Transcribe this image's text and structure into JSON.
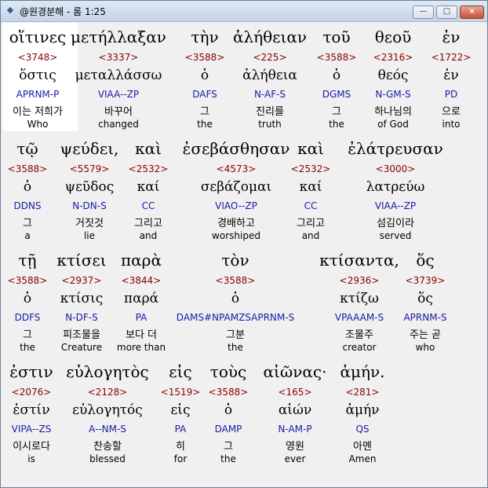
{
  "window": {
    "title": "@원경분해 - 롬 1:25",
    "buttons": {
      "minimize": "—",
      "maximize": "□",
      "close": "×"
    }
  },
  "rows": [
    {
      "words": [
        {
          "greek": "οἵτινες",
          "strong": "<3748>",
          "lemma": "ὅστις",
          "parse": "APRNM-P",
          "korean": "이는 저희가",
          "english": "Who"
        },
        {
          "greek": "μετήλλαξαν",
          "strong": "<3337>",
          "lemma": "μεταλλάσσω",
          "parse": "VIAA--ZP",
          "korean": "바꾸어",
          "english": "changed"
        },
        {
          "greek": "τὴν",
          "strong": "<3588>",
          "lemma": "ὁ",
          "parse": "DAFS",
          "korean": "그",
          "english": "the"
        },
        {
          "greek": "ἀλήθειαν",
          "strong": "<225>",
          "lemma": "ἀλήθεια",
          "parse": "N-AF-S",
          "korean": "진리를",
          "english": "truth"
        },
        {
          "greek": "τοῦ",
          "strong": "<3588>",
          "lemma": "ὁ",
          "parse": "DGMS",
          "korean": "그",
          "english": "the"
        },
        {
          "greek": "θεοῦ",
          "strong": "<2316>",
          "lemma": "θεός",
          "parse": "N-GM-S",
          "korean": "하나님의",
          "english": "of God"
        },
        {
          "greek": "ἐν",
          "strong": "<1722>",
          "lemma": "ἐν",
          "parse": "PD",
          "korean": "으로",
          "english": "into"
        }
      ]
    },
    {
      "words": [
        {
          "greek": "τῷ",
          "strong": "<3588>",
          "lemma": "ὁ",
          "parse": "DDNS",
          "korean": "그",
          "english": "a"
        },
        {
          "greek": "ψεύδει,",
          "strong": "<5579>",
          "lemma": "ψεῦδος",
          "parse": "N-DN-S",
          "korean": "거짓것",
          "english": "lie"
        },
        {
          "greek": "καὶ",
          "strong": "<2532>",
          "lemma": "καί",
          "parse": "CC",
          "korean": "그리고",
          "english": "and"
        },
        {
          "greek": "ἐσεβάσθησαν",
          "strong": "<4573>",
          "lemma": "σεβάζομαι",
          "parse": "VIAO--ZP",
          "korean": "경배하고",
          "english": "worshiped"
        },
        {
          "greek": "καὶ",
          "strong": "<2532>",
          "lemma": "καί",
          "parse": "CC",
          "korean": "그리고",
          "english": "and"
        },
        {
          "greek": "ἐλάτρευσαν",
          "strong": "<3000>",
          "lemma": "λατρεύω",
          "parse": "VIAA--ZP",
          "korean": "섬김이라",
          "english": "served"
        }
      ]
    },
    {
      "words": [
        {
          "greek": "τῇ",
          "strong": "<3588>",
          "lemma": "ὁ",
          "parse": "DDFS",
          "korean": "그",
          "english": "the"
        },
        {
          "greek": "κτίσει",
          "strong": "<2937>",
          "lemma": "κτίσις",
          "parse": "N-DF-S",
          "korean": "피조물을",
          "english": "Creature"
        },
        {
          "greek": "παρὰ",
          "strong": "<3844>",
          "lemma": "παρά",
          "parse": "PA",
          "korean": "보다 더",
          "english": "more than"
        },
        {
          "greek": "τὸν",
          "strong": "<3588>",
          "lemma": "ὁ",
          "parse": "DAMS#NPAMZSAPRNM-S",
          "korean": "그분",
          "english": "the"
        },
        {
          "greek": "κτίσαντα,",
          "strong": "<2936>",
          "lemma": "κτίζω",
          "parse": "VPAAAM-S",
          "korean": "조물주",
          "english": "creator"
        },
        {
          "greek": "ὅς",
          "strong": "<3739>",
          "lemma": "ὅς",
          "parse": "APRNM-S",
          "korean": "주는 곧",
          "english": "who"
        }
      ]
    },
    {
      "words": [
        {
          "greek": "ἐστιν",
          "strong": "<2076>",
          "lemma": "ἐστίν",
          "parse": "VIPA--ZS",
          "korean": "이시로다",
          "english": "is"
        },
        {
          "greek": "εὐλογητὸς",
          "strong": "<2128>",
          "lemma": "εὐλογητός",
          "parse": "A--NM-S",
          "korean": "찬송할",
          "english": "blessed"
        },
        {
          "greek": "εἰς",
          "strong": "<1519>",
          "lemma": "εἰς",
          "parse": "PA",
          "korean": "히",
          "english": "for"
        },
        {
          "greek": "τοὺς",
          "strong": "<3588>",
          "lemma": "ὁ",
          "parse": "DAMP",
          "korean": "그",
          "english": "the"
        },
        {
          "greek": "αἰῶνας·",
          "strong": "<165>",
          "lemma": "αἰών",
          "parse": "N-AM-P",
          "korean": "영원",
          "english": "ever"
        },
        {
          "greek": "ἀμήν.",
          "strong": "<281>",
          "lemma": "ἀμήν",
          "parse": "QS",
          "korean": "아멘",
          "english": "Amen"
        }
      ]
    }
  ]
}
